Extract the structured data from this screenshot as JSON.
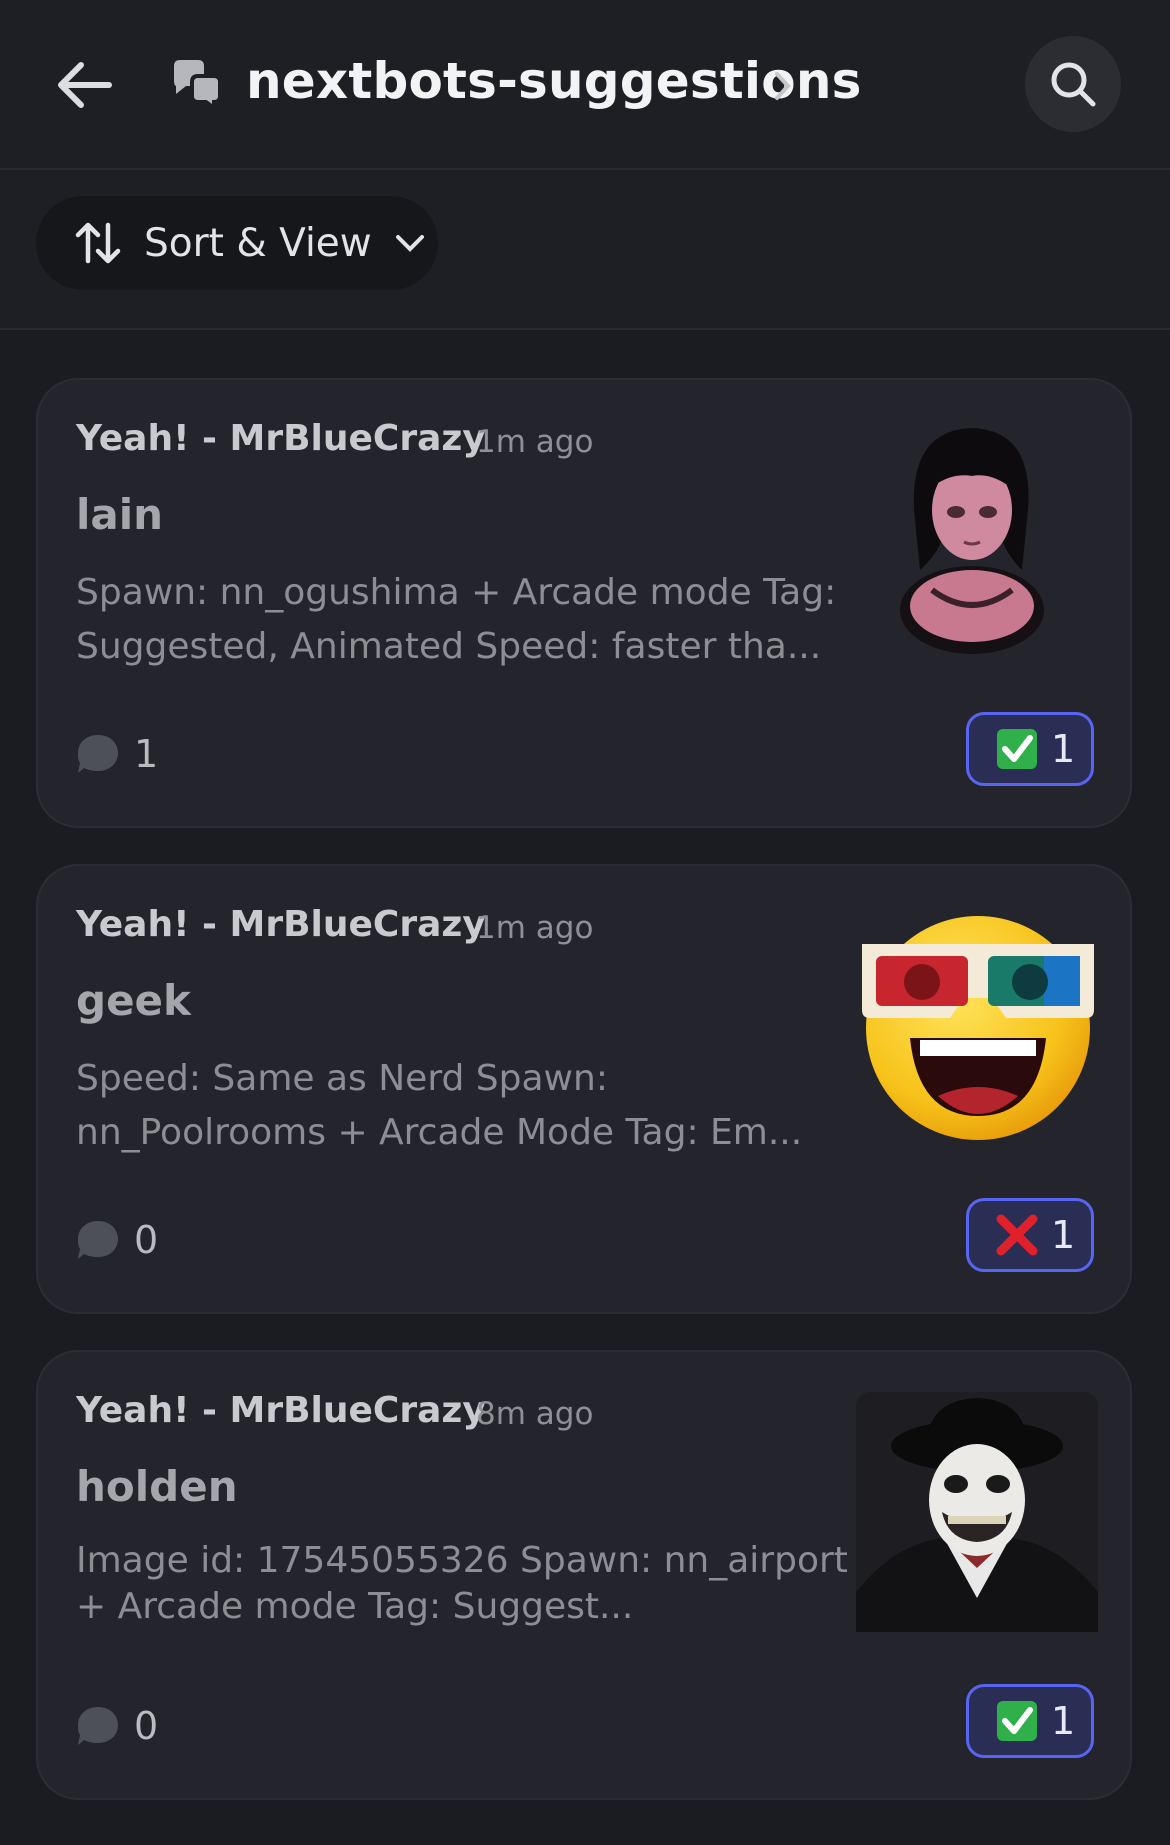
{
  "header": {
    "title": "nextbots-suggestions",
    "back_icon": "arrow-left-icon",
    "channel_icon": "forum-channel-icon",
    "search_icon": "search-icon"
  },
  "sort": {
    "label": "Sort & View"
  },
  "colors": {
    "accent": "#5865f2",
    "background": "#1b1c21",
    "card": "#24252c"
  },
  "posts": [
    {
      "author": "Yeah! - MrBlueCrazy",
      "time": "1m ago",
      "title": "lain",
      "preview": "Spawn: nn_ogushima + Arcade mode Tag: Suggested, Animated Speed: faster tha...",
      "comments": "1",
      "reaction_icon": "check-mark-icon",
      "reaction_count": "1"
    },
    {
      "author": "Yeah! - MrBlueCrazy",
      "time": "1m ago",
      "title": "geek",
      "preview": "Speed: Same as Nerd Spawn: nn_Poolrooms + Arcade Mode Tag: Em...",
      "comments": "0",
      "reaction_icon": "cross-mark-icon",
      "reaction_count": "1"
    },
    {
      "author": "Yeah! - MrBlueCrazy",
      "time": "8m ago",
      "title": "holden",
      "preview": "Image id: 17545055326 Spawn: nn_airport + Arcade mode Tag: Suggest...",
      "comments": "0",
      "reaction_icon": "check-mark-icon",
      "reaction_count": "1"
    }
  ]
}
